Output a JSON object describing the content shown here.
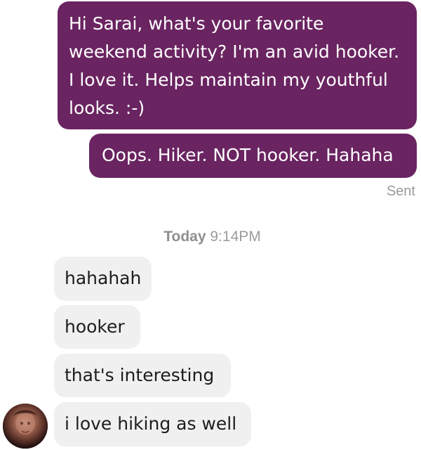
{
  "messages": {
    "sent": [
      {
        "text": "Hi Sarai, what's your favorite weekend activity? I'm an avid hooker. I love it. Helps maintain my youthful looks. :-)"
      },
      {
        "text": "Oops. Hiker. NOT hooker. Hahaha"
      }
    ],
    "status": "Sent",
    "timestamp": {
      "day": "Today",
      "time": "9:14PM"
    },
    "received": [
      {
        "text": "hahahah"
      },
      {
        "text": "hooker"
      },
      {
        "text": "that's interesting"
      },
      {
        "text": "i love hiking as well"
      }
    ]
  },
  "colors": {
    "sent_bubble": "#6a2461",
    "received_bubble": "#f0f0f0",
    "meta_text": "#9a9a9a"
  },
  "icons": {
    "avatar": "contact-avatar"
  }
}
